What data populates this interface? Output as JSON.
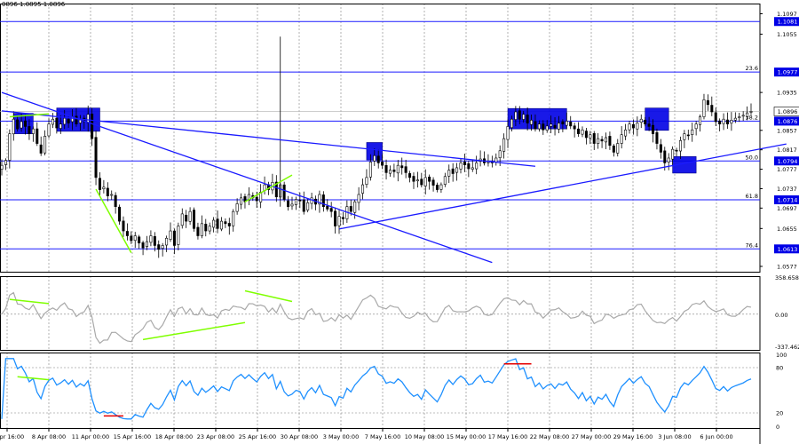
{
  "header": {
    "ohlc_label": "0896 1.0895 1.0896"
  },
  "colors": {
    "candle": "#000000",
    "level_line": "#1a1aff",
    "trend_line": "#1a1aff",
    "highlight_box": "#0000e6",
    "price_box_bg": "#0000e6",
    "divergence": "#7fff00",
    "divergence_red": "#e60000",
    "cci_line": "#a9a9a9",
    "rsi_line": "#1e90ff",
    "grid": "#7f7f7f",
    "frame": "#000000"
  },
  "chart_data": [
    {
      "type": "candlestick",
      "pane": "price",
      "ylim": [
        1.0566,
        1.1118
      ],
      "price_ticks": [
        "1.1097",
        "1.1055",
        "1.0935",
        "1.0857",
        "1.0817",
        "1.0777",
        "1.0737",
        "1.0697",
        "1.0655",
        "1.0577"
      ],
      "current_price": "1.0896",
      "fibo_levels": [
        {
          "label": "",
          "price_label": "1.1081",
          "price": 1.1081
        },
        {
          "label": "23.6",
          "price_label": "1.0977",
          "price": 1.0977
        },
        {
          "label": "38.2",
          "price_label": "1.0876",
          "price": 1.0876
        },
        {
          "label": "50.0",
          "price_label": "1.0794",
          "price": 1.0794
        },
        {
          "label": "61.8",
          "price_label": "1.0714",
          "price": 1.0714
        },
        {
          "label": "76.4",
          "price_label": "1.0613",
          "price": 1.0613
        }
      ],
      "trend_lines": [
        {
          "from": [
            0,
            1.0935
          ],
          "to": [
            125,
            1.0585
          ]
        },
        {
          "from": [
            0,
            1.0897
          ],
          "to": [
            136,
            1.0783
          ]
        },
        {
          "from": [
            86,
            1.0654
          ],
          "to": [
            200,
            1.0829
          ]
        }
      ],
      "divergence_lines": [
        {
          "from": [
            2,
            1.0885
          ],
          "to": [
            12,
            1.0891
          ]
        },
        {
          "from": [
            24,
            1.0736
          ],
          "to": [
            33,
            1.0605
          ]
        },
        {
          "from": [
            62,
            1.071
          ],
          "to": [
            74,
            1.0765
          ]
        }
      ],
      "highlight_boxes": [
        {
          "x": [
            3,
            8
          ],
          "y": [
            1.085,
            1.0892
          ]
        },
        {
          "x": [
            14,
            25
          ],
          "y": [
            1.0855,
            1.0903
          ]
        },
        {
          "x": [
            93,
            97
          ],
          "y": [
            1.0796,
            1.0832
          ]
        },
        {
          "x": [
            129,
            144
          ],
          "y": [
            1.086,
            1.0902
          ]
        },
        {
          "x": [
            164,
            170
          ],
          "y": [
            1.0857,
            1.0903
          ]
        },
        {
          "x": [
            171,
            177
          ],
          "y": [
            1.0769,
            1.0803
          ]
        }
      ],
      "closes": [
        1.0785,
        1.0795,
        1.085,
        1.088,
        1.086,
        1.0875,
        1.0865,
        1.085,
        1.086,
        1.083,
        1.081,
        1.0845,
        1.087,
        1.088,
        1.0862,
        1.087,
        1.0882,
        1.0872,
        1.0885,
        1.087,
        1.088,
        1.0875,
        1.089,
        1.084,
        1.076,
        1.0735,
        1.074,
        1.0722,
        1.0725,
        1.07,
        1.067,
        1.065,
        1.064,
        1.063,
        1.064,
        1.0625,
        1.0615,
        1.0628,
        1.064,
        1.062,
        1.0612,
        1.062,
        1.0635,
        1.065,
        1.062,
        1.066,
        1.0685,
        1.067,
        1.069,
        1.0655,
        1.064,
        1.0665,
        1.065,
        1.066,
        1.0672,
        1.0655,
        1.067,
        1.0665,
        1.066,
        1.069,
        1.0706,
        1.0718,
        1.071,
        1.0725,
        1.0718,
        1.0712,
        1.073,
        1.0745,
        1.0735,
        1.075,
        1.072,
        1.0745,
        1.0715,
        1.07,
        1.0705,
        1.0715,
        1.0712,
        1.069,
        1.0708,
        1.0718,
        1.0705,
        1.0725,
        1.07,
        1.0695,
        1.069,
        1.066,
        1.068,
        1.0675,
        1.07,
        1.069,
        1.071,
        1.0725,
        1.0745,
        1.076,
        1.0792,
        1.0805,
        1.079,
        1.0785,
        1.077,
        1.0775,
        1.0772,
        1.0785,
        1.078,
        1.077,
        1.076,
        1.0752,
        1.0755,
        1.0745,
        1.076,
        1.0752,
        1.0744,
        1.0735,
        1.0745,
        1.0762,
        1.0775,
        1.0768,
        1.078,
        1.079,
        1.0786,
        1.0778,
        1.078,
        1.079,
        1.0798,
        1.079,
        1.0792,
        1.079,
        1.08,
        1.0815,
        1.084,
        1.0865,
        1.088,
        1.0895,
        1.088,
        1.089,
        1.0872,
        1.0878,
        1.086,
        1.087,
        1.0858,
        1.0866,
        1.087,
        1.0862,
        1.0872,
        1.087,
        1.0876,
        1.0866,
        1.086,
        1.085,
        1.0858,
        1.0842,
        1.0848,
        1.083,
        1.084,
        1.0835,
        1.0842,
        1.0826,
        1.0812,
        1.083,
        1.0848,
        1.0858,
        1.087,
        1.0862,
        1.0872,
        1.088,
        1.087,
        1.0865,
        1.085,
        1.083,
        1.0812,
        1.079,
        1.08,
        1.0818,
        1.0815,
        1.0836,
        1.085,
        1.0846,
        1.0858,
        1.087,
        1.0885,
        1.092,
        1.091,
        1.0895,
        1.0875,
        1.087,
        1.088,
        1.087,
        1.0878,
        1.0882,
        1.0885,
        1.0888,
        1.0893,
        1.0896
      ]
    },
    {
      "type": "line",
      "pane": "cci",
      "ylim": [
        -337.462,
        358.6587
      ],
      "tick_labels": [
        "358.6587",
        "0.00",
        "-337.462"
      ],
      "divergence_lines": [
        {
          "from": [
            2,
            140
          ],
          "to": [
            12,
            100
          ]
        },
        {
          "from": [
            36,
            -240
          ],
          "to": [
            62,
            -80
          ]
        },
        {
          "from": [
            62,
            220
          ],
          "to": [
            74,
            120
          ]
        }
      ]
    },
    {
      "type": "line",
      "pane": "rsi",
      "ylim": [
        0,
        100
      ],
      "tick_labels": [
        "100",
        "80",
        "20",
        "0"
      ],
      "levels": [
        80,
        20
      ],
      "divergence_lines": [
        {
          "from": [
            4,
            68
          ],
          "to": [
            12,
            64
          ]
        }
      ],
      "red_markers": [
        {
          "from": [
            26,
            16
          ],
          "to": [
            31,
            16
          ]
        },
        {
          "from": [
            128,
            85
          ],
          "to": [
            135,
            85
          ]
        }
      ]
    }
  ],
  "time_axis": {
    "labels": [
      "3 Apr 16:00",
      "8 Apr 08:00",
      "11 Apr 00:00",
      "15 Apr 16:00",
      "18 Apr 08:00",
      "23 Apr 08:00",
      "25 Apr 16:00",
      "30 Apr 08:00",
      "3 May 00:00",
      "7 May 16:00",
      "10 May 08:00",
      "15 May 00:00",
      "17 May 16:00",
      "22 May 08:00",
      "27 May 00:00",
      "29 May 16:00",
      "3 Jun 08:00",
      "6 Jun 00:00"
    ]
  }
}
